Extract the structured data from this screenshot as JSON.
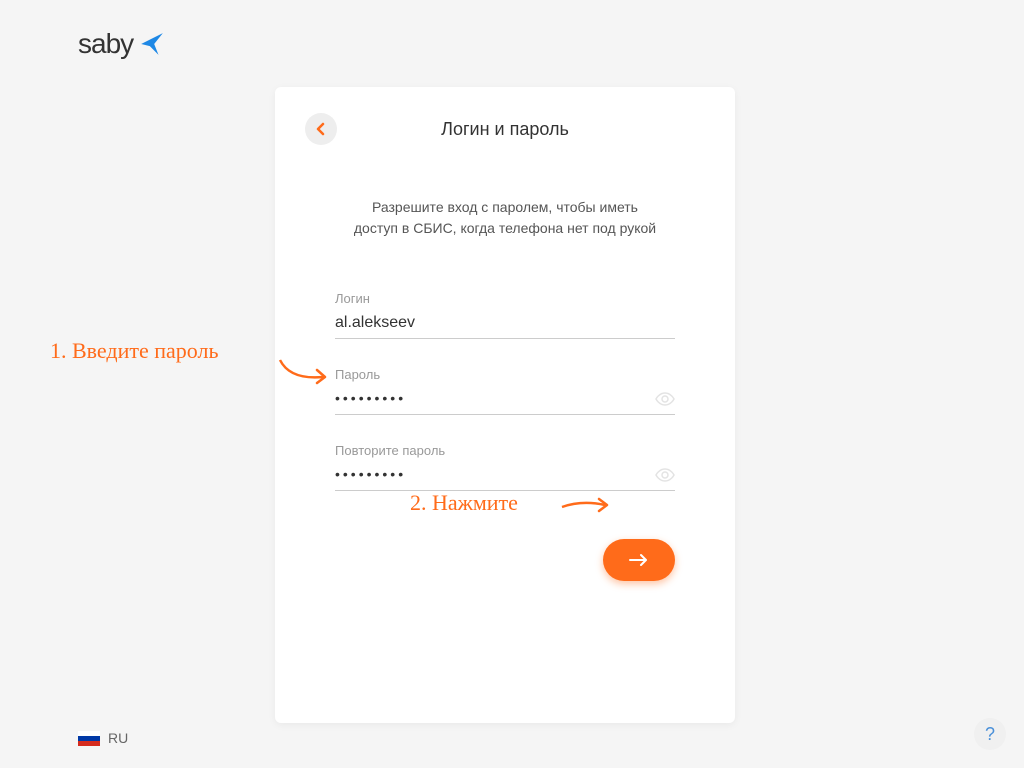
{
  "logo": {
    "text": "saby"
  },
  "card": {
    "title": "Логин и пароль",
    "description_line1": "Разрешите вход с паролем, чтобы иметь",
    "description_line2": "доступ в СБИС, когда телефона нет под рукой"
  },
  "form": {
    "login_label": "Логин",
    "login_value": "al.alekseev",
    "password_label": "Пароль",
    "password_value": "•••••••••",
    "repeat_password_label": "Повторите пароль",
    "repeat_password_value": "•••••••••"
  },
  "annotations": {
    "step1": "1. Введите пароль",
    "step2": "2. Нажмите"
  },
  "footer": {
    "lang": "RU",
    "help": "?"
  },
  "colors": {
    "accent": "#ff6b1a",
    "logo_bird": "#1e88e5"
  }
}
